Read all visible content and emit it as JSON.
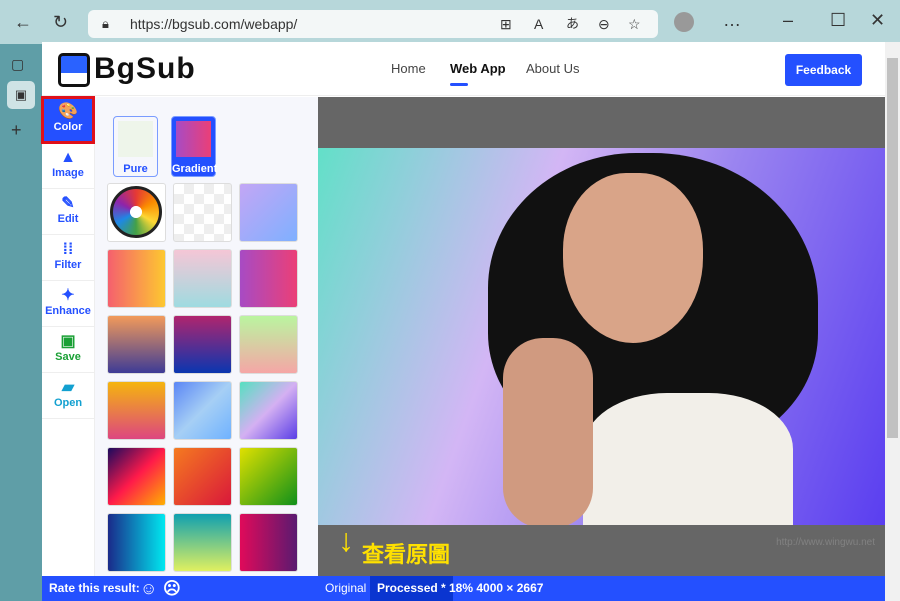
{
  "browser": {
    "url": "https://bgsub.com/webapp/"
  },
  "header": {
    "logo": "BgSub",
    "nav": [
      "Home",
      "Web App",
      "About Us"
    ],
    "feedback": "Feedback"
  },
  "tools": [
    {
      "label": "Color",
      "icon": "palette-icon",
      "glyph": "🎨"
    },
    {
      "label": "Image",
      "icon": "image-icon",
      "glyph": "▲"
    },
    {
      "label": "Edit",
      "icon": "pencil-icon",
      "glyph": "✎"
    },
    {
      "label": "Filter",
      "icon": "filter-icon",
      "glyph": "⁞⁞"
    },
    {
      "label": "Enhance",
      "icon": "sparkle-icon",
      "glyph": "✦"
    },
    {
      "label": "Save",
      "icon": "save-icon",
      "glyph": "▣"
    },
    {
      "label": "Open",
      "icon": "folder-open-icon",
      "glyph": "▰"
    }
  ],
  "panel": {
    "pure": "Pure",
    "gradient": "Gradient",
    "swatches": [
      "conic-gradient(#e53935,#fb8c00,#fdd835,#43a047,#1e88e5,#8e24aa,#e53935)",
      "repeating-conic-gradient(#eee 0 25%,#fff 0 50%) 0 0/20px 20px",
      "linear-gradient(135deg,#c3a6f5,#7fb0ff)",
      "linear-gradient(90deg,#f5606e,#fdc830)",
      "linear-gradient(#f5c6d6,#9fdbe0)",
      "linear-gradient(90deg,#a74bc4,#eb3f77)",
      "linear-gradient(#f29a5a,#3d3b96)",
      "linear-gradient(#b0256e,#0a36b0)",
      "linear-gradient(#baf5a0,#f5a6a6)",
      "linear-gradient(#f5b50e,#dd4680)",
      "linear-gradient(135deg,#5b86f5,#a6cff5,#6fb2ff)",
      "linear-gradient(135deg,#56e0c0,#d4b0f2,#5a3ee6)",
      "linear-gradient(135deg,#1a0a5e,#ff1a4a,#ffb000)",
      "linear-gradient(135deg,#f57a20,#d9183a)",
      "linear-gradient(135deg,#e0e000,#10901a)",
      "linear-gradient(90deg,#1a2a8a,#00e8f0)",
      "linear-gradient(#10a0b0,#e0f060)",
      "linear-gradient(90deg,#e00a5a,#5a1a70)"
    ]
  },
  "canvas": {
    "annotation": "查看原圖",
    "watermark": "http://www.wingwu.net"
  },
  "status": {
    "rate": "Rate this result:",
    "happy": "☺",
    "sad": "☹",
    "original": "Original",
    "processed": "Processed *",
    "info": "18% 4000 × 2667"
  }
}
